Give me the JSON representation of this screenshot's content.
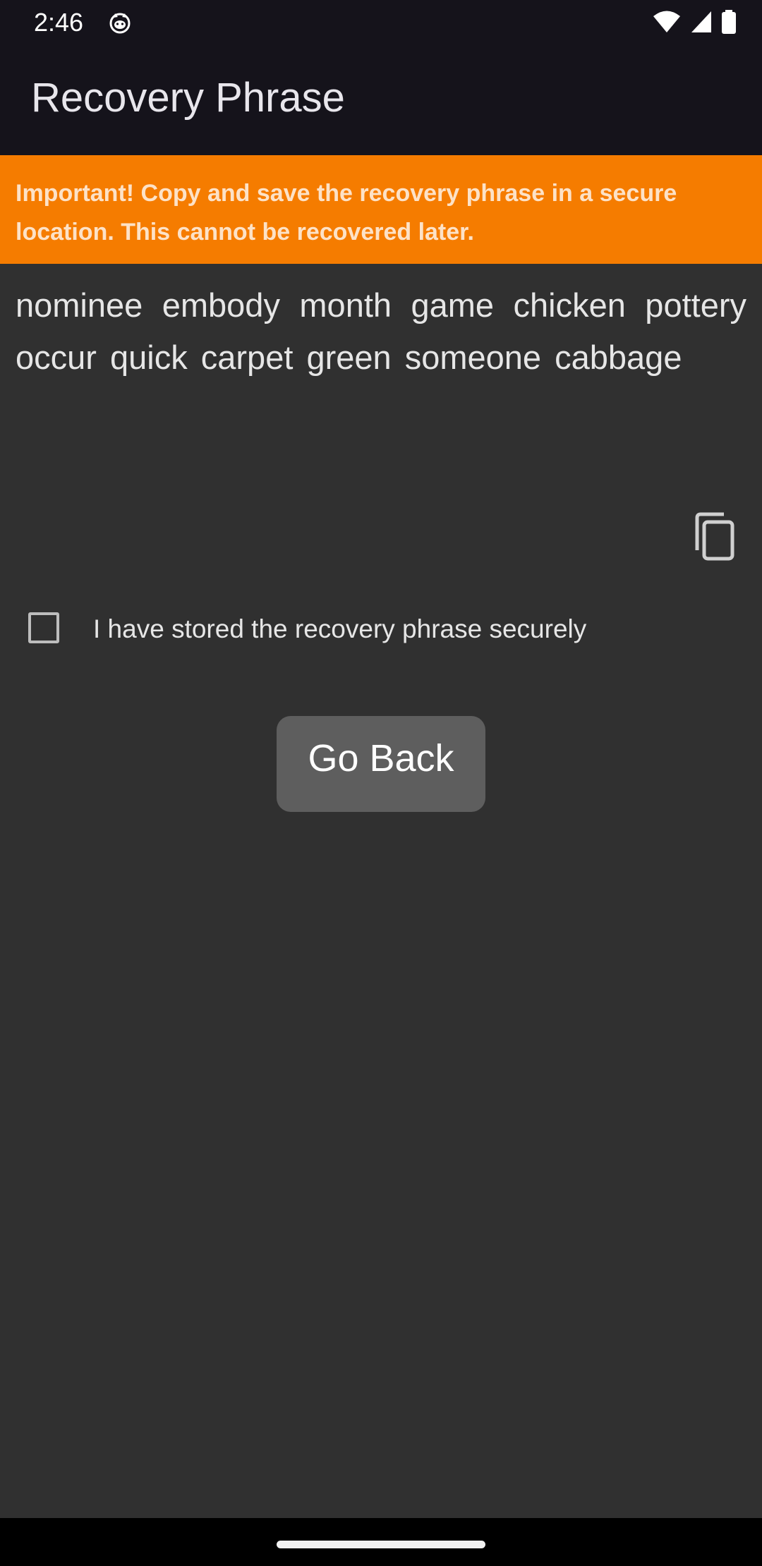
{
  "status_bar": {
    "time": "2:46",
    "icons": [
      "cat-icon",
      "wifi-icon",
      "cell-signal-icon",
      "battery-icon"
    ]
  },
  "app_bar": {
    "title": "Recovery Phrase"
  },
  "warning": {
    "text": "Important! Copy and save the recovery phrase in a secure location. This cannot be recovered later.",
    "color": "#f57c00"
  },
  "phrase": {
    "text": "nominee embody month game chicken pottery occur quick carpet green someone cabbage",
    "copy_icon": "copy-icon"
  },
  "confirm": {
    "label": "I have stored the recovery phrase securely",
    "checked": false
  },
  "actions": {
    "go_back_label": "Go Back"
  },
  "colors": {
    "background": "#303030",
    "app_bar": "#15131b",
    "button": "#5e5e5e"
  }
}
